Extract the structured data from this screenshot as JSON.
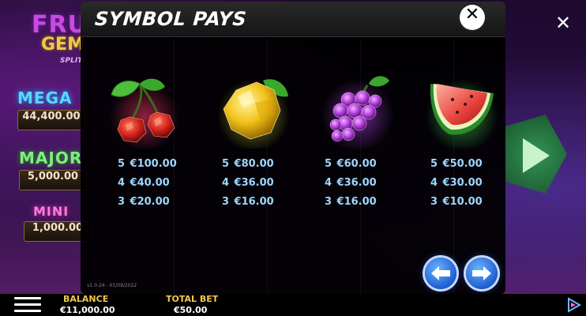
{
  "game": {
    "logo": {
      "line1": "FRU",
      "line2": "GEM",
      "line3": "SPLIT"
    },
    "jackpots": [
      {
        "title": "MEGA",
        "value": "44,400.00"
      },
      {
        "title": "MAJOR",
        "value": "5,000.00"
      },
      {
        "title": "MINI",
        "value": "1,000.00"
      }
    ],
    "close_label": "✕"
  },
  "panel": {
    "title": "SYMBOL PAYS",
    "close_label": "✕",
    "version": "v1.0.24 - 01/09/2022",
    "symbols": [
      {
        "name": "cherry",
        "pays": [
          {
            "count": "5",
            "amount": "€100.00"
          },
          {
            "count": "4",
            "amount": "€40.00"
          },
          {
            "count": "3",
            "amount": "€20.00"
          }
        ]
      },
      {
        "name": "lemon",
        "pays": [
          {
            "count": "5",
            "amount": "€80.00"
          },
          {
            "count": "4",
            "amount": "€36.00"
          },
          {
            "count": "3",
            "amount": "€16.00"
          }
        ]
      },
      {
        "name": "grapes",
        "pays": [
          {
            "count": "5",
            "amount": "€60.00"
          },
          {
            "count": "4",
            "amount": "€36.00"
          },
          {
            "count": "3",
            "amount": "€16.00"
          }
        ]
      },
      {
        "name": "watermelon",
        "pays": [
          {
            "count": "5",
            "amount": "€50.00"
          },
          {
            "count": "4",
            "amount": "€30.00"
          },
          {
            "count": "3",
            "amount": "€10.00"
          }
        ]
      }
    ]
  },
  "bottom_bar": {
    "balance_label": "BALANCE",
    "balance_value": "€11,000.00",
    "bet_label": "TOTAL BET",
    "bet_value": "€50.00"
  },
  "colors": {
    "accent_gold": "#f2c94a",
    "pay_text": "#9fd6ff",
    "nav_button": "#1d5fd0"
  }
}
